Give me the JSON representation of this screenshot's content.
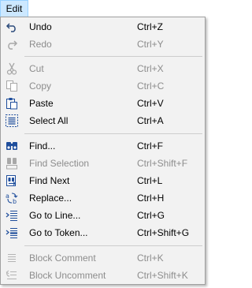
{
  "menubar": {
    "edit_label": "Edit"
  },
  "menu": {
    "items": [
      {
        "label": "Undo",
        "shortcut": "Ctrl+Z",
        "enabled": true,
        "icon": "undo-icon"
      },
      {
        "label": "Redo",
        "shortcut": "Ctrl+Y",
        "enabled": false,
        "icon": "redo-icon"
      },
      {
        "label": "Cut",
        "shortcut": "Ctrl+X",
        "enabled": false,
        "icon": "cut-icon"
      },
      {
        "label": "Copy",
        "shortcut": "Ctrl+C",
        "enabled": false,
        "icon": "copy-icon"
      },
      {
        "label": "Paste",
        "shortcut": "Ctrl+V",
        "enabled": true,
        "icon": "paste-icon"
      },
      {
        "label": "Select All",
        "shortcut": "Ctrl+A",
        "enabled": true,
        "icon": "select-all-icon"
      },
      {
        "label": "Find...",
        "shortcut": "Ctrl+F",
        "enabled": true,
        "icon": "find-icon"
      },
      {
        "label": "Find Selection",
        "shortcut": "Ctrl+Shift+F",
        "enabled": false,
        "icon": "find-selection-icon"
      },
      {
        "label": "Find Next",
        "shortcut": "Ctrl+L",
        "enabled": true,
        "icon": "find-next-icon"
      },
      {
        "label": "Replace...",
        "shortcut": "Ctrl+H",
        "enabled": true,
        "icon": "replace-icon"
      },
      {
        "label": "Go to Line...",
        "shortcut": "Ctrl+G",
        "enabled": true,
        "icon": "go-to-line-icon"
      },
      {
        "label": "Go to Token...",
        "shortcut": "Ctrl+Shift+G",
        "enabled": true,
        "icon": "go-to-token-icon"
      },
      {
        "label": "Block Comment",
        "shortcut": "Ctrl+K",
        "enabled": false,
        "icon": "block-comment-icon"
      },
      {
        "label": "Block Uncomment",
        "shortcut": "Ctrl+Shift+K",
        "enabled": false,
        "icon": "block-uncomment-icon"
      }
    ]
  },
  "colors": {
    "menubar_highlight": "#cce8ff",
    "menu_background": "#f2f2f2",
    "disabled_text": "#8d8d8d",
    "icon_blue": "#1f4e9c"
  }
}
